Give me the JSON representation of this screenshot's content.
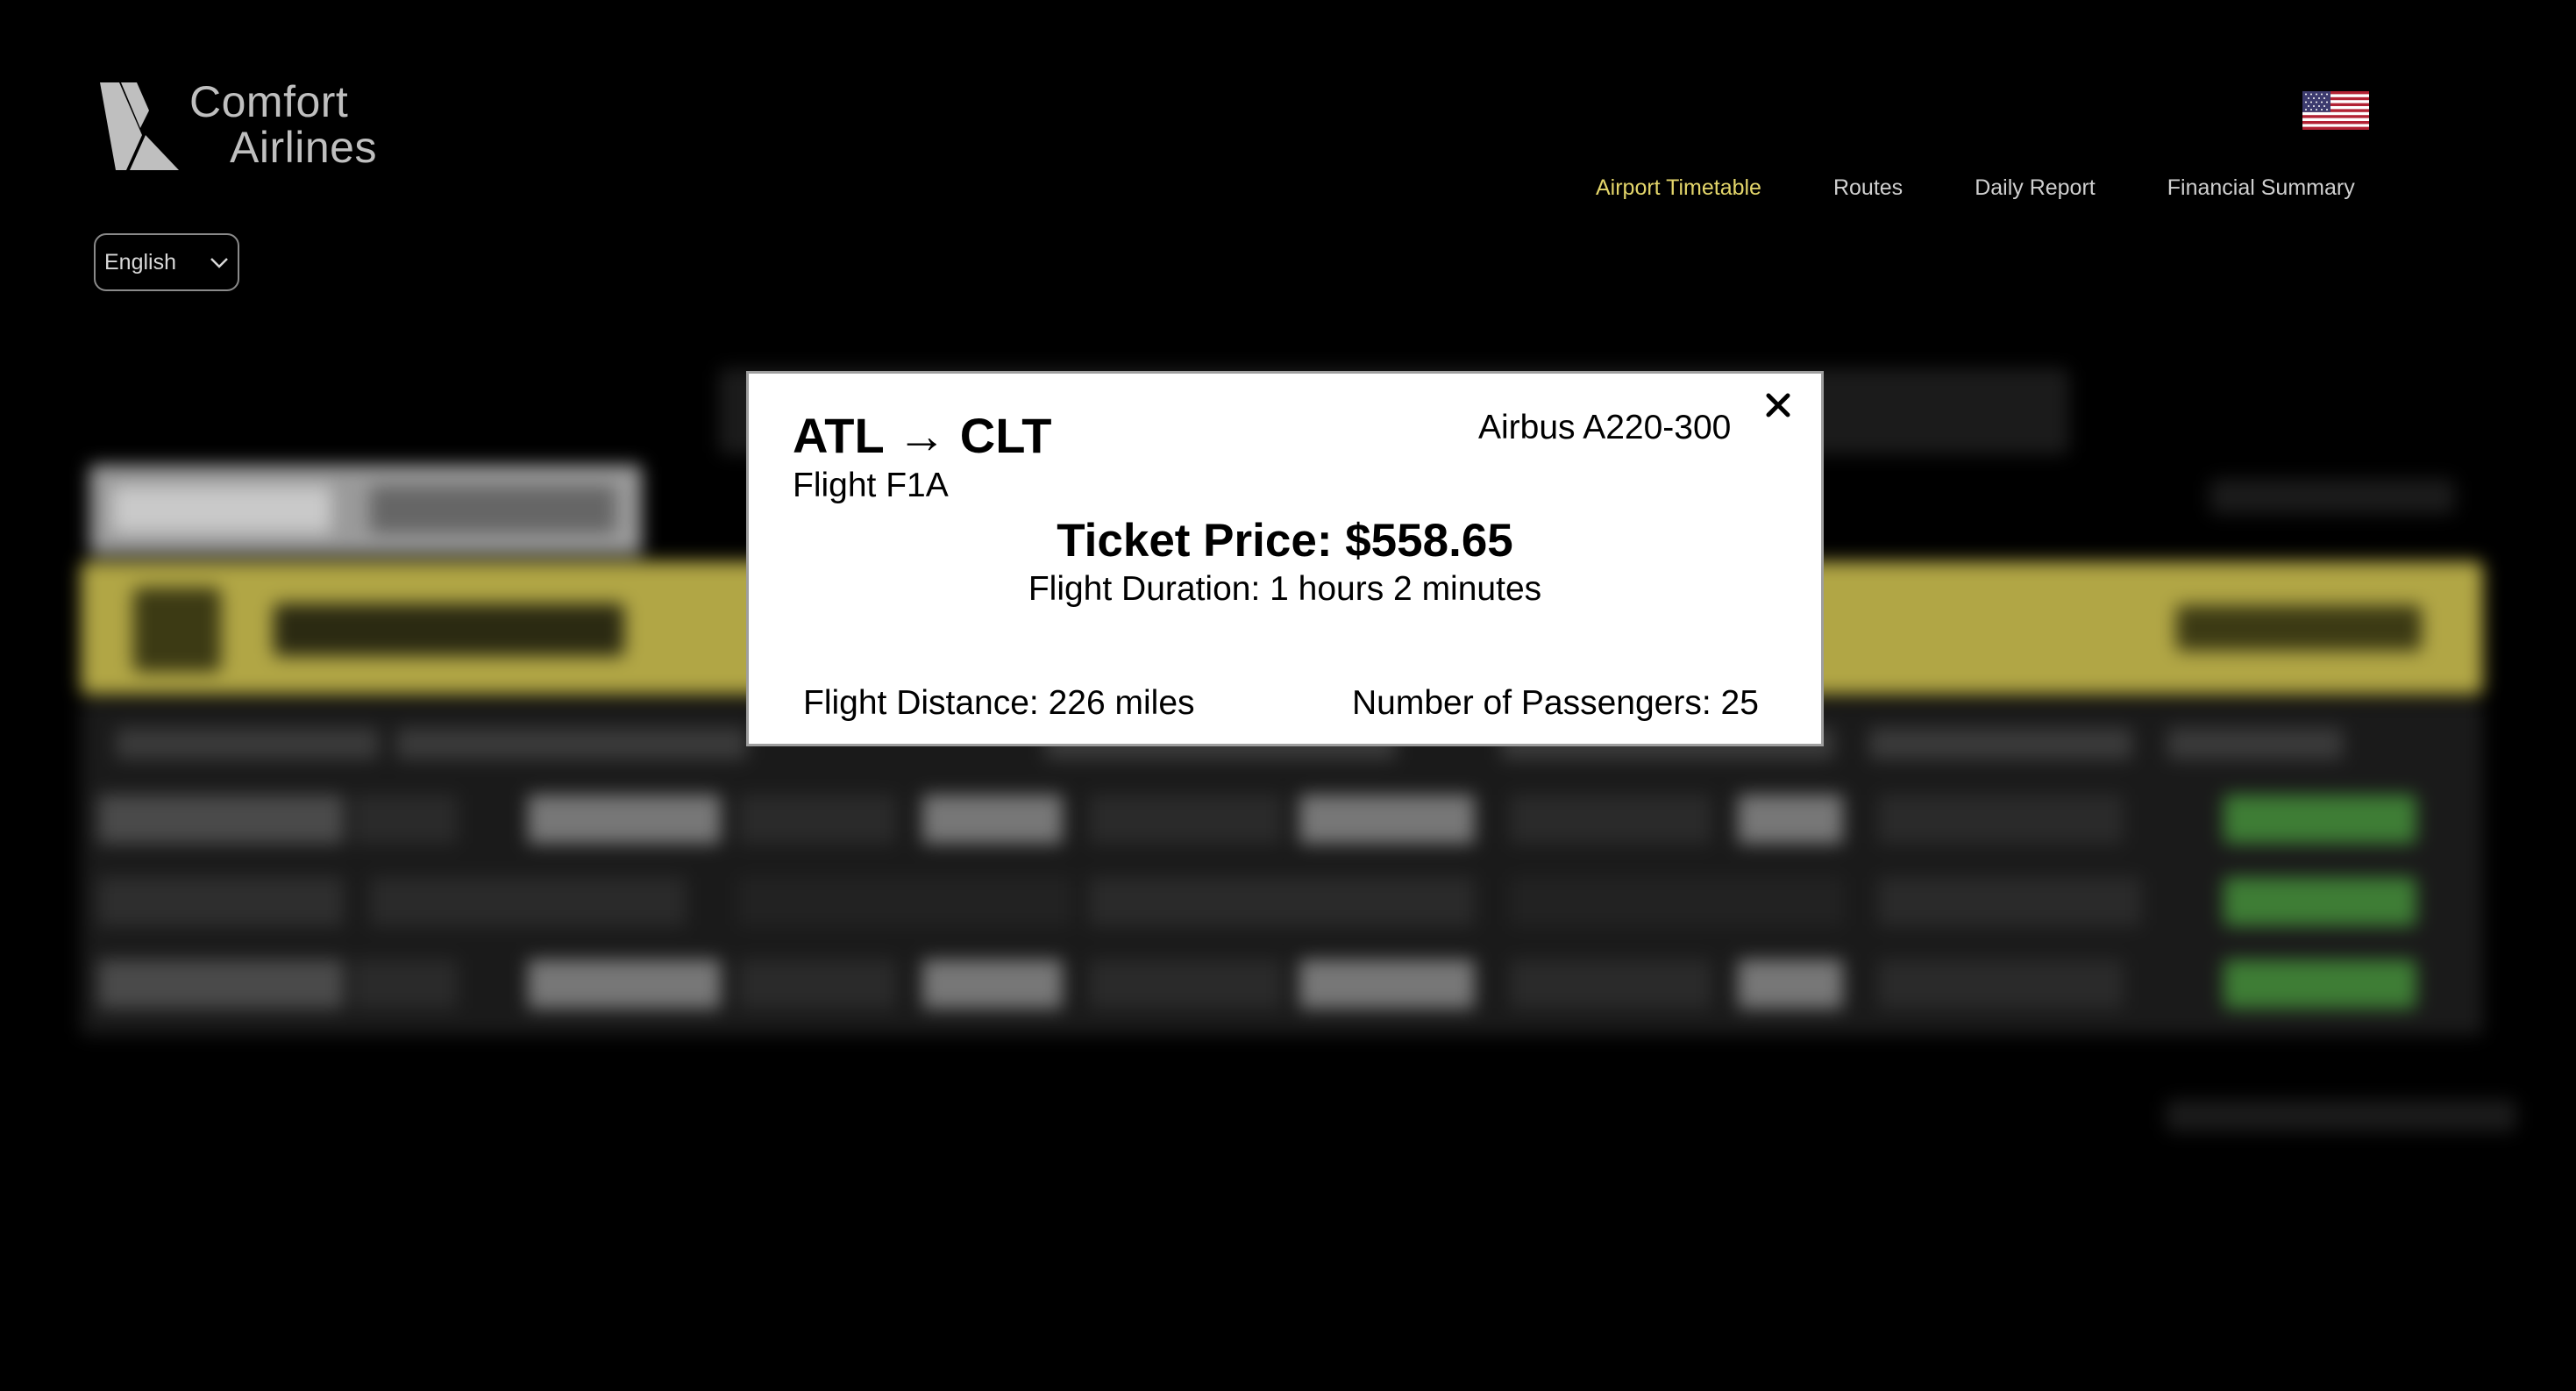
{
  "header": {
    "logo": {
      "line1": "Comfort",
      "line2": "Airlines"
    },
    "flag_icon": "us-flag-icon",
    "nav": [
      {
        "label": "Airport Timetable",
        "active": true
      },
      {
        "label": "Routes",
        "active": false
      },
      {
        "label": "Daily Report",
        "active": false
      },
      {
        "label": "Financial Summary",
        "active": false
      }
    ],
    "language_select": {
      "value": "English"
    }
  },
  "modal": {
    "route": "ATL → CLT",
    "flight": "Flight F1A",
    "aircraft": "Airbus A220-300",
    "ticket_price": "Ticket Price: $558.65",
    "duration": "Flight Duration: 1 hours 2 minutes",
    "distance": "Flight Distance: 226 miles",
    "passengers": "Number of Passengers: 25",
    "close_icon": "close-icon"
  },
  "colors": {
    "background": "#000000",
    "nav_active": "#e3d56a",
    "nav_default": "#cfcfcf",
    "banner": "#b1a645",
    "schedule_button": "#3e7d35",
    "modal_bg": "#ffffff"
  }
}
